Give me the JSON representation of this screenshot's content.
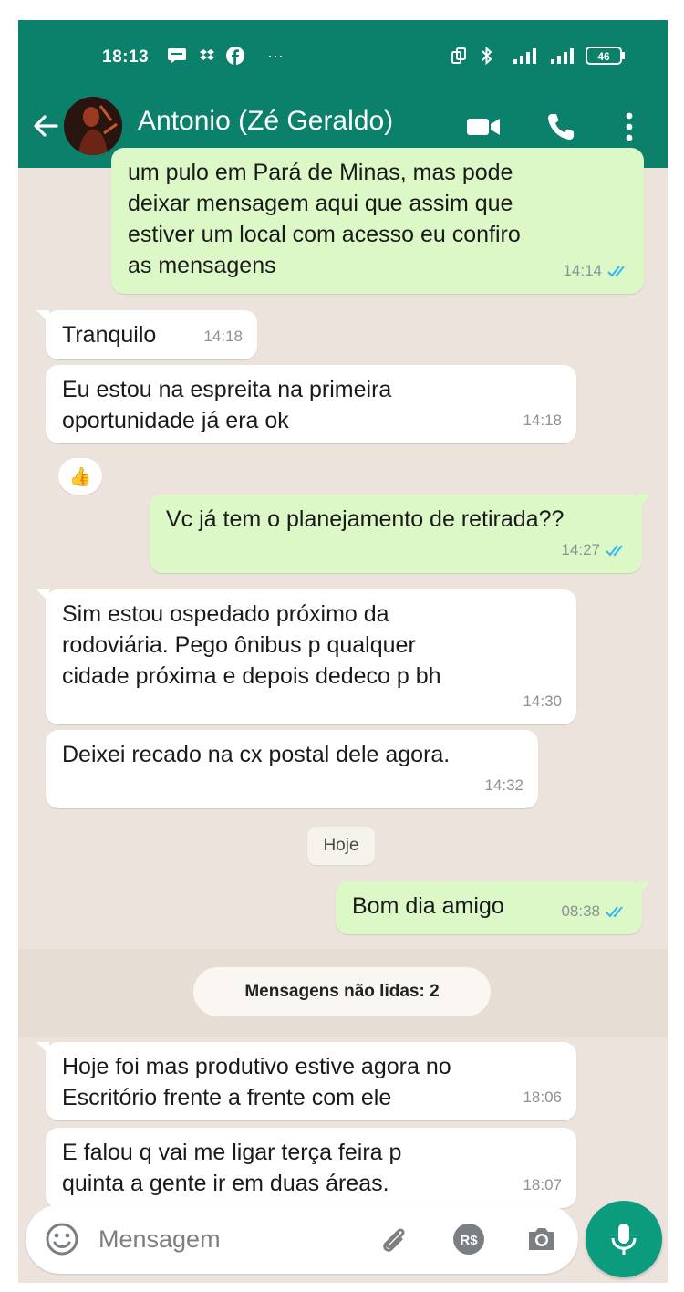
{
  "status_bar": {
    "time": "18:13",
    "more": "···",
    "battery": "46"
  },
  "header": {
    "contact_name": "Antonio (Zé Geraldo)"
  },
  "messages": [
    {
      "dir": "out",
      "text": "um pulo em Pará de Minas, mas pode\ndeixar mensagem aqui que assim que\nestiver um local com acesso eu confiro\nas mensagens",
      "time": "14:14",
      "read": true
    },
    {
      "dir": "in",
      "text": "Tranquilo",
      "time": "14:18"
    },
    {
      "dir": "in",
      "text": "Eu estou  na espreita  na primeira\noportunidade já era ok",
      "time": "14:18",
      "reaction": "👍"
    },
    {
      "dir": "out",
      "text": "Vc já tem o planejamento de retirada??",
      "time": "14:27",
      "read": true
    },
    {
      "dir": "in",
      "text": "Sim estou  ospedado próximo da\nrodoviária. Pego ônibus p qualquer\ncidade  próxima e depois  dedeco p bh",
      "time": "14:30"
    },
    {
      "dir": "in",
      "text": "Deixei recado  na cx postal  dele agora.",
      "time": "14:32"
    },
    {
      "dir": "out",
      "text": "Bom dia amigo",
      "time": "08:38",
      "read": true
    },
    {
      "dir": "in",
      "text": "Hoje  foi  mas produtivo estive  agora no\nEscritório  frente a frente com ele",
      "time": "18:06"
    },
    {
      "dir": "in",
      "text": "E falou  q vai me ligar  terça  feira  p\nquinta  a gente  ir em duas  áreas.",
      "time": "18:07"
    }
  ],
  "date_divider": "Hoje",
  "unread_divider": "Mensagens não lidas: 2",
  "composer": {
    "placeholder": "Mensagem",
    "payment_label": "R$"
  },
  "colors": {
    "header": "#0b806b",
    "outgoing_bubble": "#dcf8c6",
    "incoming_bubble": "#ffffff",
    "chat_background": "#ece4dc",
    "read_ticks": "#34b7f1",
    "mic_button": "#0a9c7d"
  },
  "icons": [
    "back-arrow-icon",
    "video-call-icon",
    "phone-icon",
    "more-vert-icon",
    "emoji-icon",
    "attach-icon",
    "payment-icon",
    "camera-icon",
    "mic-icon"
  ]
}
